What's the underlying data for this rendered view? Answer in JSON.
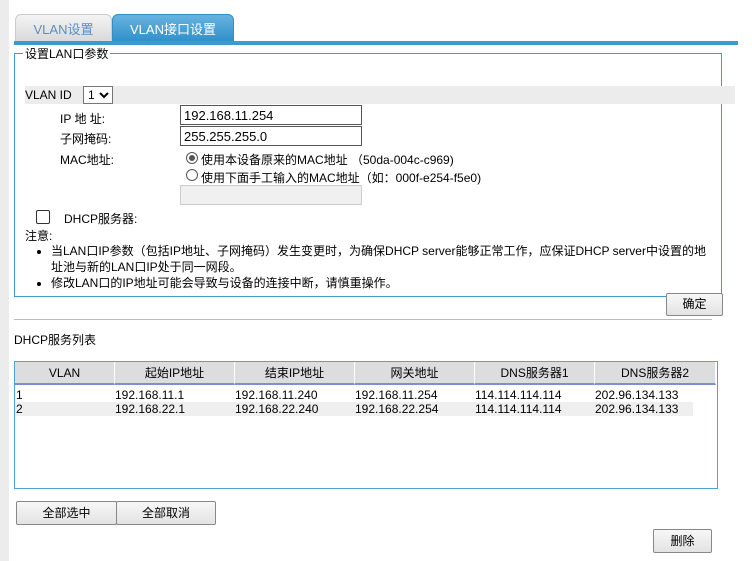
{
  "tabs": [
    {
      "label": "VLAN设置"
    },
    {
      "label": "VLAN接口设置"
    }
  ],
  "lan": {
    "legend": "设置LAN口参数",
    "vlan_id_label": "VLAN ID",
    "vlan_id_value": "1",
    "ip_label": "IP 地 址:",
    "ip_value": "192.168.11.254",
    "mask_label": "子网掩码:",
    "mask_value": "255.255.255.0",
    "mac_label": "MAC地址:",
    "mac_opt1": "使用本设备原来的MAC地址 （50da-004c-c969)",
    "mac_opt2": "使用下面手工输入的MAC地址（如：000f-e254-f5e0)",
    "mac_value": "",
    "dhcp_label": "DHCP服务器:",
    "note_label": "注意:",
    "notes": [
      "当LAN口IP参数（包括IP地址、子网掩码）发生变更时，为确保DHCP server能够正常工作，应保证DHCP server中设置的地址池与新的LAN口IP处于同一网段。",
      "修改LAN口的IP地址可能会导致与设备的连接中断，请慎重操作。"
    ],
    "ok": "确定"
  },
  "dhcp": {
    "title": "DHCP服务列表",
    "columns": [
      "VLAN",
      "起始IP地址",
      "结束IP地址",
      "网关地址",
      "DNS服务器1",
      "DNS服务器2"
    ],
    "rows": [
      [
        "1",
        "192.168.11.1",
        "192.168.11.240",
        "192.168.11.254",
        "114.114.114.114",
        "202.96.134.133"
      ],
      [
        "2",
        "192.168.22.1",
        "192.168.22.240",
        "192.168.22.254",
        "114.114.114.114",
        "202.96.134.133"
      ]
    ],
    "select_all": "全部选中",
    "deselect_all": "全部取消",
    "delete": "删除"
  }
}
